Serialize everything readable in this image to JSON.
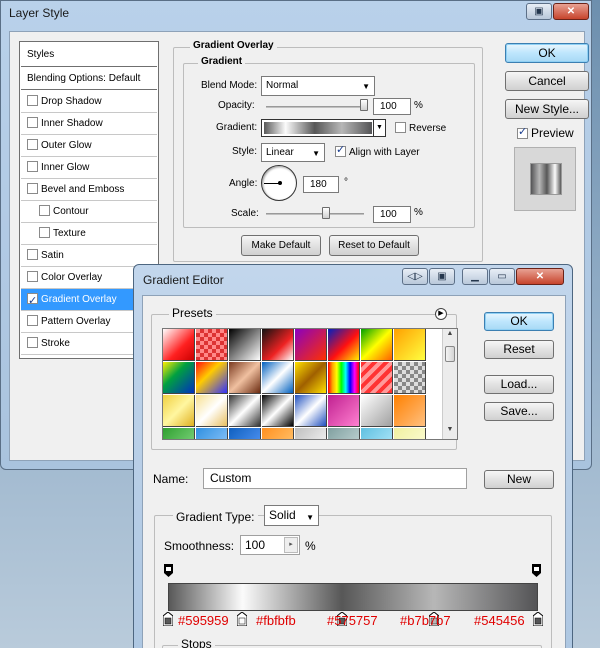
{
  "layer_style": {
    "title": "Layer Style",
    "styles_header": "Styles",
    "blending_options": "Blending Options: Default",
    "items": [
      {
        "label": "Drop Shadow",
        "checked": false,
        "indent": false,
        "selected": false
      },
      {
        "label": "Inner Shadow",
        "checked": false,
        "indent": false,
        "selected": false
      },
      {
        "label": "Outer Glow",
        "checked": false,
        "indent": false,
        "selected": false
      },
      {
        "label": "Inner Glow",
        "checked": false,
        "indent": false,
        "selected": false
      },
      {
        "label": "Bevel and Emboss",
        "checked": false,
        "indent": false,
        "selected": false
      },
      {
        "label": "Contour",
        "checked": false,
        "indent": true,
        "selected": false
      },
      {
        "label": "Texture",
        "checked": false,
        "indent": true,
        "selected": false
      },
      {
        "label": "Satin",
        "checked": false,
        "indent": false,
        "selected": false
      },
      {
        "label": "Color Overlay",
        "checked": false,
        "indent": false,
        "selected": false
      },
      {
        "label": "Gradient Overlay",
        "checked": true,
        "indent": false,
        "selected": true
      },
      {
        "label": "Pattern Overlay",
        "checked": false,
        "indent": false,
        "selected": false
      },
      {
        "label": "Stroke",
        "checked": false,
        "indent": false,
        "selected": false
      }
    ],
    "panel_title": "Gradient Overlay",
    "gradient_group": "Gradient",
    "blend_mode_label": "Blend Mode:",
    "blend_mode_value": "Normal",
    "opacity_label": "Opacity:",
    "opacity_value": "100",
    "opacity_unit": "%",
    "gradient_label": "Gradient:",
    "reverse_label": "Reverse",
    "style_label": "Style:",
    "style_value": "Linear",
    "align_label": "Align with Layer",
    "angle_label": "Angle:",
    "angle_value": "180",
    "angle_unit": "°",
    "scale_label": "Scale:",
    "scale_value": "100",
    "scale_unit": "%",
    "make_default": "Make Default",
    "reset_default": "Reset to Default",
    "ok": "OK",
    "cancel": "Cancel",
    "new_style": "New Style...",
    "preview_label": "Preview"
  },
  "gradient_editor": {
    "title": "Gradient Editor",
    "presets_label": "Presets",
    "ok": "OK",
    "reset": "Reset",
    "load": "Load...",
    "save": "Save...",
    "name_label": "Name:",
    "name_value": "Custom",
    "new_button": "New",
    "gradient_type_label": "Gradient Type:",
    "gradient_type_value": "Solid",
    "smoothness_label": "Smoothness:",
    "smoothness_value": "100",
    "smoothness_unit": "%",
    "stops_label": "Stops",
    "stop_colors": [
      "#595959",
      "#fbfbfb",
      "#575757",
      "#b7b7b7",
      "#545456"
    ],
    "stop_positions": [
      0,
      0.2,
      0.47,
      0.72,
      1.0
    ]
  },
  "colors": {
    "selection": "#3399ff",
    "annotation": "#e00000"
  }
}
